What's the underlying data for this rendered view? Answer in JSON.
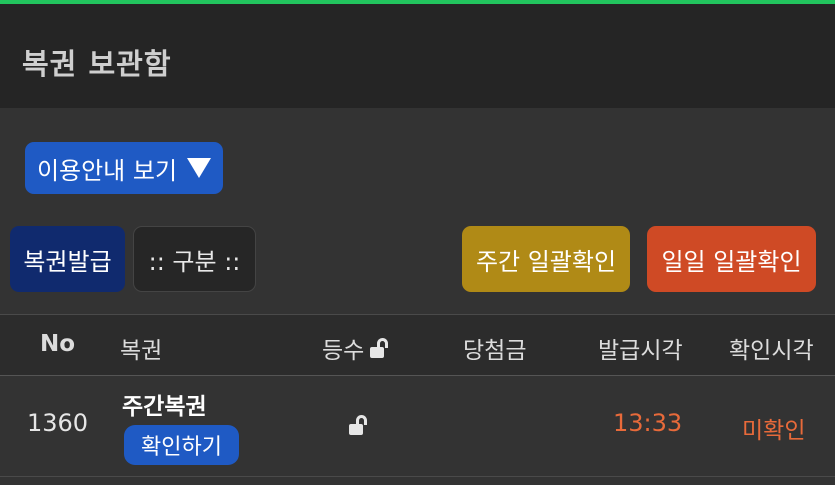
{
  "header": {
    "title": "복권 보관함"
  },
  "guide_button": {
    "label": "이용안내 보기"
  },
  "toolbar": {
    "issue_label": "복권발급",
    "category_label": ":: 구분 ::",
    "weekly_confirm_label": "주간 일괄확인",
    "daily_confirm_label": "일일 일괄확인"
  },
  "table": {
    "columns": [
      "No",
      "복권",
      "등수",
      "당첨금",
      "발급시각",
      "확인시각"
    ],
    "rows": [
      {
        "no": "1360",
        "ticket": "주간복권",
        "action": "확인하기",
        "grade": "",
        "prize": "",
        "issued": "13:33",
        "confirmed": "미확인"
      }
    ]
  },
  "colors": {
    "accent_top": "#22c55e",
    "primary_blue": "#1f5ac4",
    "weekly": "#b08a16",
    "daily": "#cf4a25",
    "status_text": "#e86a3a"
  }
}
